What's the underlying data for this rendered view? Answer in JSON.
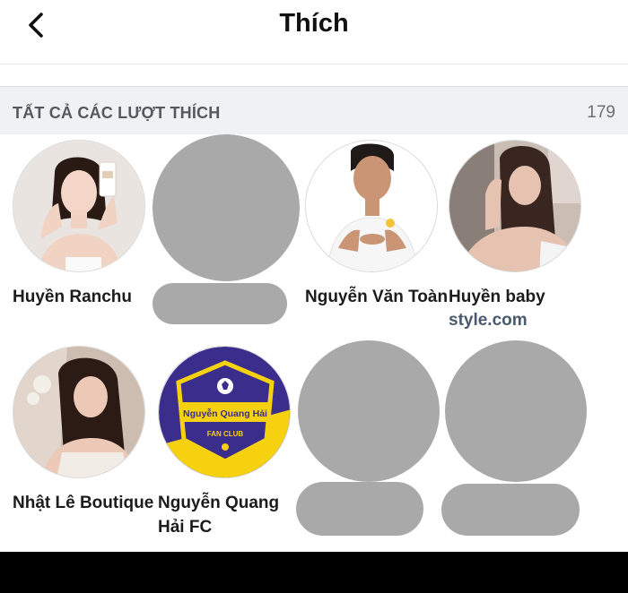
{
  "header": {
    "title": "Thích",
    "back_icon": "chevron-left-icon"
  },
  "likes": {
    "section_label": "TẤT CẢ CÁC LƯỢT THÍCH",
    "count": "179",
    "items": [
      {
        "name": "Huyền Ranchu",
        "sub": ""
      },
      {
        "name": "",
        "sub": ""
      },
      {
        "name": "Nguyễn Văn Toàn",
        "sub": ""
      },
      {
        "name": "Huyền baby",
        "sub": "style.com"
      },
      {
        "name": "Nhật Lê Boutique",
        "sub": ""
      },
      {
        "name": "Nguyễn Quang Hải FC",
        "sub": ""
      },
      {
        "name": "",
        "sub": ""
      },
      {
        "name": "",
        "sub": ""
      }
    ]
  },
  "logo": {
    "title": "Nguyễn Quang Hải",
    "tag": "FAN CLUB"
  },
  "colors": {
    "blank_avatar": "#a9a9a9",
    "section_bg": "#f0f1f3",
    "link_text": "#4a5a6e",
    "logo_purple": "#3b2d8c",
    "logo_yellow": "#f5d10f"
  }
}
